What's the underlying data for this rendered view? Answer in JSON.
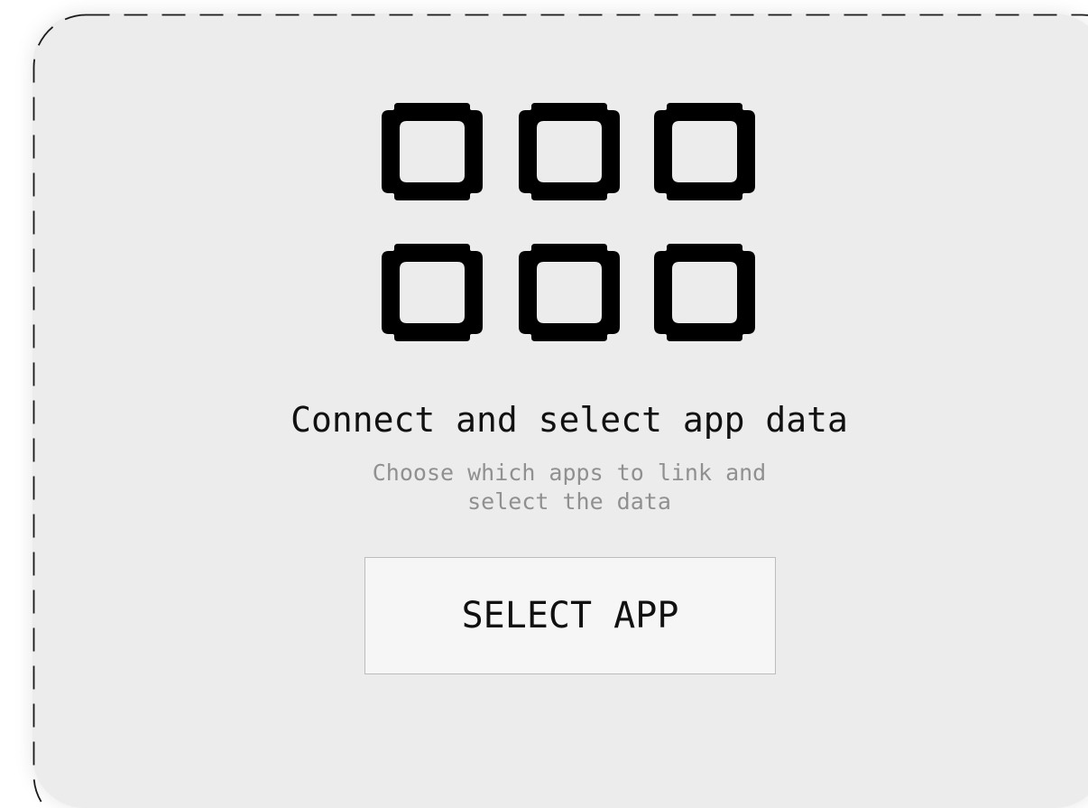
{
  "empty_state": {
    "icon": "app-grid-icon",
    "title": "Connect and select app data",
    "subtitle_lines": [
      "Choose which apps to link and",
      "select the data"
    ],
    "button_label": "SELECT APP"
  },
  "colors": {
    "card_background": "#ececec",
    "border_dash": "#1a1a1a",
    "title": "#111111",
    "subtitle": "#909090",
    "button_background": "#f6f6f6",
    "icon": "#000000"
  }
}
